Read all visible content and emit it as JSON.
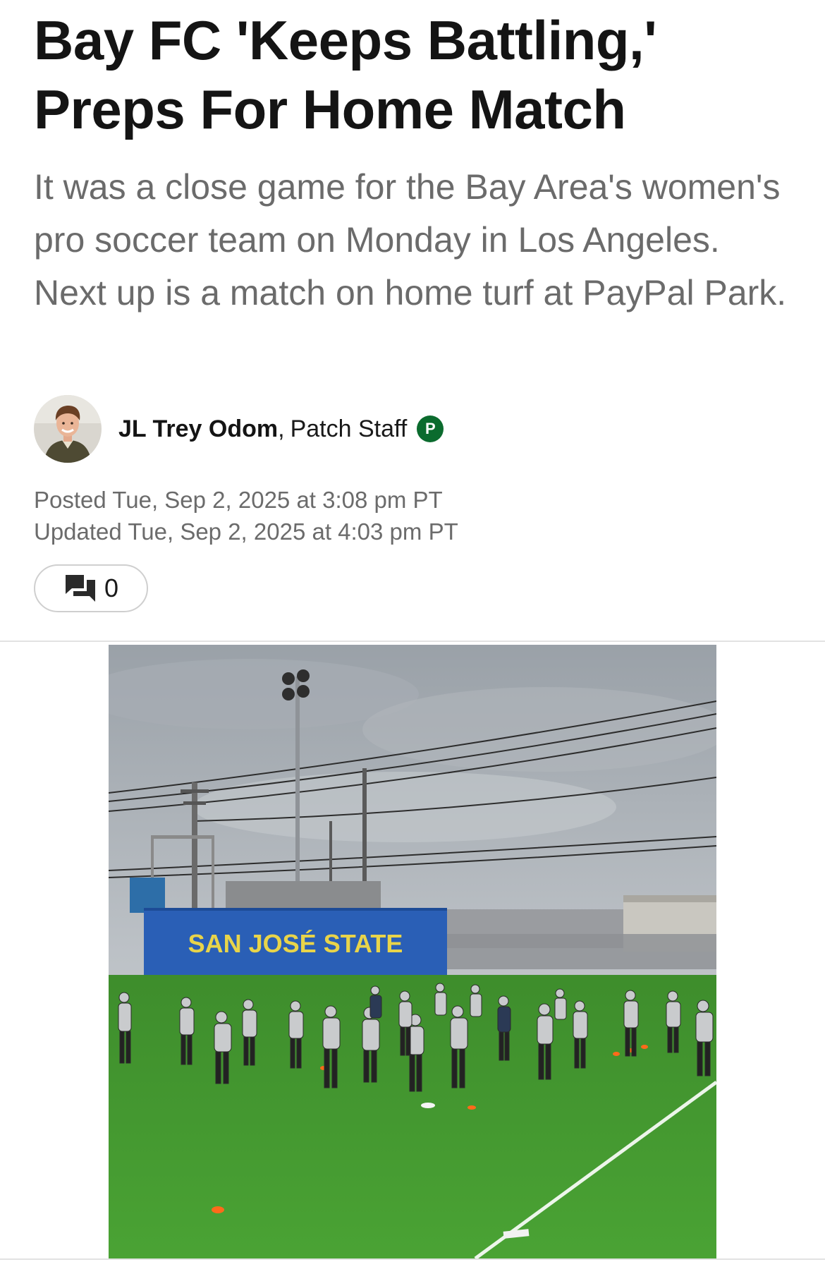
{
  "article": {
    "headline": "Bay FC 'Keeps Battling,' Preps For Home Match",
    "dek": "It was a close game for the Bay Area's women's pro soccer team on Monday in Los Angeles. Next up is a match on home turf at PayPal Park.",
    "author": {
      "name": "JL Trey Odom",
      "separator": ",",
      "role": "Patch Staff",
      "badge_letter": "P",
      "badge_color": "#0b6b2e"
    },
    "posted": "Posted Tue, Sep 2, 2025 at 3:08 pm PT",
    "updated": "Updated Tue, Sep 2, 2025 at 4:03 pm PT",
    "comments": {
      "icon": "comment-icon",
      "count": "0"
    },
    "photo": {
      "banner_text": "SAN JOSÉ STATE"
    }
  }
}
